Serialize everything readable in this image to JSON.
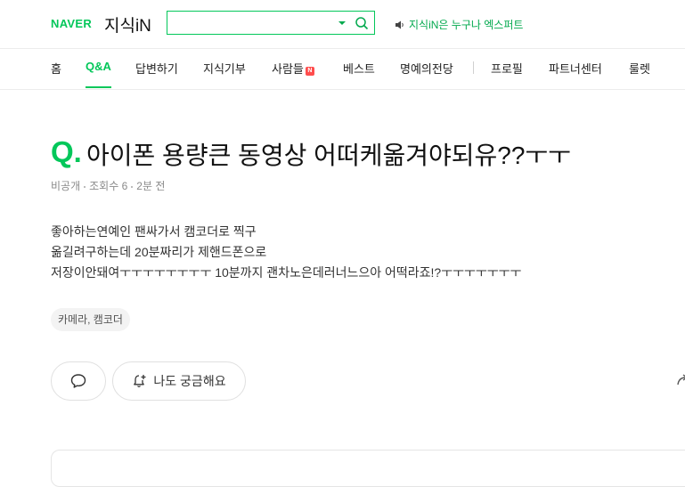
{
  "header": {
    "brand": "NAVER",
    "service": "지식iN",
    "search": {
      "value": "",
      "placeholder": ""
    },
    "notice": "지식iN은 누구나 엑스퍼트",
    "accent": "#03c75a"
  },
  "nav": {
    "items": [
      {
        "label": "홈"
      },
      {
        "label": "Q&A"
      },
      {
        "label": "답변하기"
      },
      {
        "label": "지식기부"
      },
      {
        "label": "사람들",
        "badge": "N"
      },
      {
        "label": "베스트"
      },
      {
        "label": "명예의전당"
      },
      {
        "label": "프로필"
      },
      {
        "label": "파트너센터"
      },
      {
        "label": "룰렛"
      }
    ],
    "active": "Q&A"
  },
  "question": {
    "mark": "Q.",
    "title": "아이폰 용량큰 동영상 어떠케옮겨야되유??ㅜㅜ",
    "author": "비공개",
    "views": "조회수 6",
    "time": "2분 전",
    "body_lines": [
      "좋아하는연예인 팬싸가서 캠코더로 찍구",
      "옮길려구하는데 20분짜리가 제핸드폰으로",
      "저장이안돼여ㅜㅜㅜㅜㅜㅜㅜㅜ 10분까지 괜차노은데러너느으아 어떡라죠!?ㅜㅜㅜㅜㅜㅜㅜ"
    ],
    "tag": "카메라, 캠코더"
  },
  "actions": {
    "curious_label": "나도 궁금해요"
  },
  "icons": [
    "search-icon",
    "dropdown-icon",
    "speaker-icon",
    "comment-icon",
    "bell-plus-icon",
    "share-icon"
  ]
}
